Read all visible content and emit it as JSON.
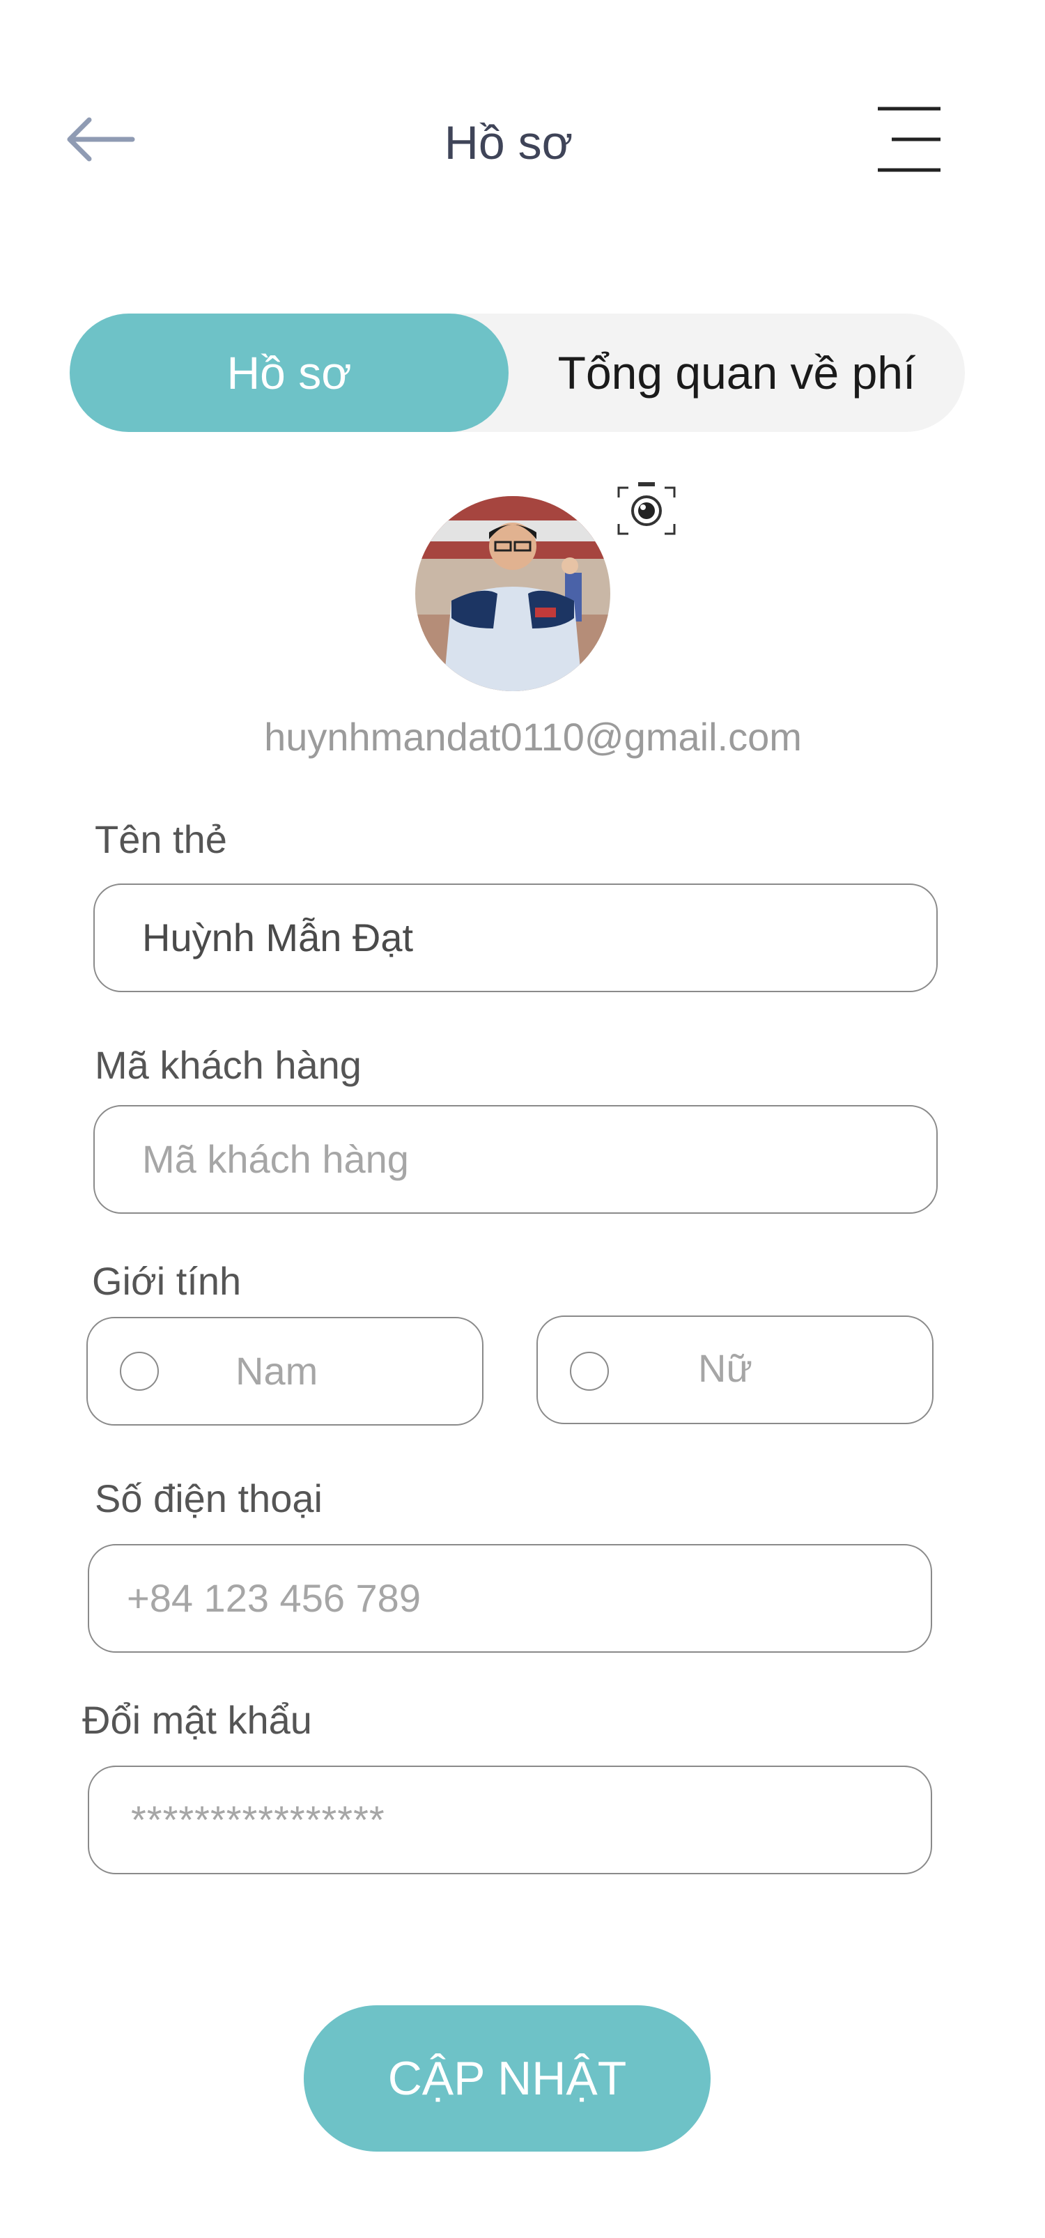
{
  "header": {
    "title": "Hồ sơ",
    "back_icon": "arrow-left-icon",
    "menu_icon": "hamburger-menu-icon"
  },
  "tabs": [
    {
      "label": "Hồ sơ",
      "active": true
    },
    {
      "label": "Tổng quan về phí",
      "active": false
    }
  ],
  "profile": {
    "email": "huynhmandat0110@gmail.com",
    "camera_icon": "camera-icon"
  },
  "form": {
    "name": {
      "label": "Tên thẻ",
      "value": "Huỳnh Mẫn Đạt"
    },
    "customer_code": {
      "label": "Mã khách hàng",
      "placeholder": "Mã khách hàng"
    },
    "gender": {
      "label": "Giới tính",
      "options": [
        "Nam",
        "Nữ"
      ]
    },
    "phone": {
      "label": "Số điện thoại",
      "placeholder": "+84 123 456 789"
    },
    "password": {
      "label": "Đổi mật khẩu",
      "placeholder": "****************"
    },
    "submit_label": "CẬP NHẬT"
  },
  "colors": {
    "accent": "#6ec2c7",
    "tab_track": "#f3f3f3",
    "title": "#3f4458"
  }
}
